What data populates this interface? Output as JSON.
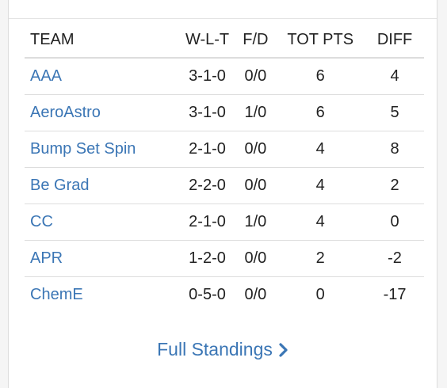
{
  "table": {
    "headers": {
      "team": "TEAM",
      "wlt": "W-L-T",
      "fd": "F/D",
      "pts": "TOT PTS",
      "diff": "DIFF"
    },
    "rows": [
      {
        "team": "AAA",
        "wlt": "3-1-0",
        "fd": "0/0",
        "pts": "6",
        "diff": "4"
      },
      {
        "team": "AeroAstro",
        "wlt": "3-1-0",
        "fd": "1/0",
        "pts": "6",
        "diff": "5"
      },
      {
        "team": "Bump Set Spin",
        "wlt": "2-1-0",
        "fd": "0/0",
        "pts": "4",
        "diff": "8"
      },
      {
        "team": "Be Grad",
        "wlt": "2-2-0",
        "fd": "0/0",
        "pts": "4",
        "diff": "2"
      },
      {
        "team": "CC",
        "wlt": "2-1-0",
        "fd": "1/0",
        "pts": "4",
        "diff": "0"
      },
      {
        "team": "APR",
        "wlt": "1-2-0",
        "fd": "0/0",
        "pts": "2",
        "diff": "-2"
      },
      {
        "team": "ChemE",
        "wlt": "0-5-0",
        "fd": "0/0",
        "pts": "0",
        "diff": "-17"
      }
    ]
  },
  "footer": {
    "link_label": "Full Standings",
    "icon": "chevron-right-icon"
  },
  "colors": {
    "link": "#3b76b5",
    "text": "#222222",
    "divider": "#dddddd"
  }
}
